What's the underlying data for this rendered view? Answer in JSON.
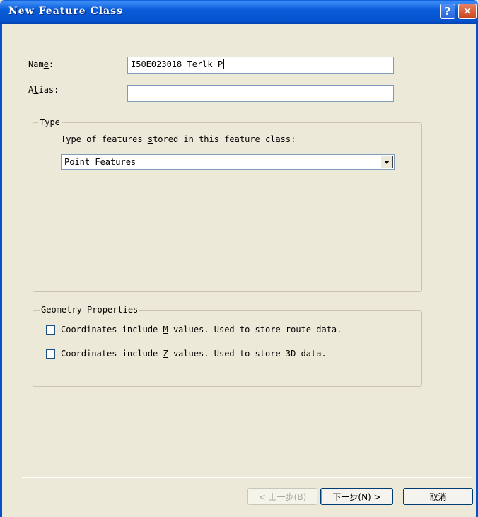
{
  "window": {
    "title": "New Feature Class",
    "help_glyph": "?",
    "close_glyph": "✕"
  },
  "form": {
    "name_label_pre": "Nam",
    "name_label_key": "e",
    "name_label_post": ":",
    "name_value": "I50E023018_Terlk_P",
    "alias_label_pre": "A",
    "alias_label_key": "l",
    "alias_label_post": "ias:",
    "alias_value": ""
  },
  "type_group": {
    "legend": "Type",
    "prompt_pre": "Type of features ",
    "prompt_key": "s",
    "prompt_post": "tored in this feature class:",
    "selected": "Point Features"
  },
  "geometry_group": {
    "legend": "Geometry Properties",
    "m_pre": "Coordinates include ",
    "m_key": "M",
    "m_post": " values. Used to store route data.",
    "m_checked": false,
    "z_pre": "Coordinates include ",
    "z_key": "Z",
    "z_post": " values. Used to store 3D data.",
    "z_checked": false
  },
  "buttons": {
    "back": "< 上一步(B)",
    "next": "下一步(N) >",
    "cancel": "取消"
  }
}
